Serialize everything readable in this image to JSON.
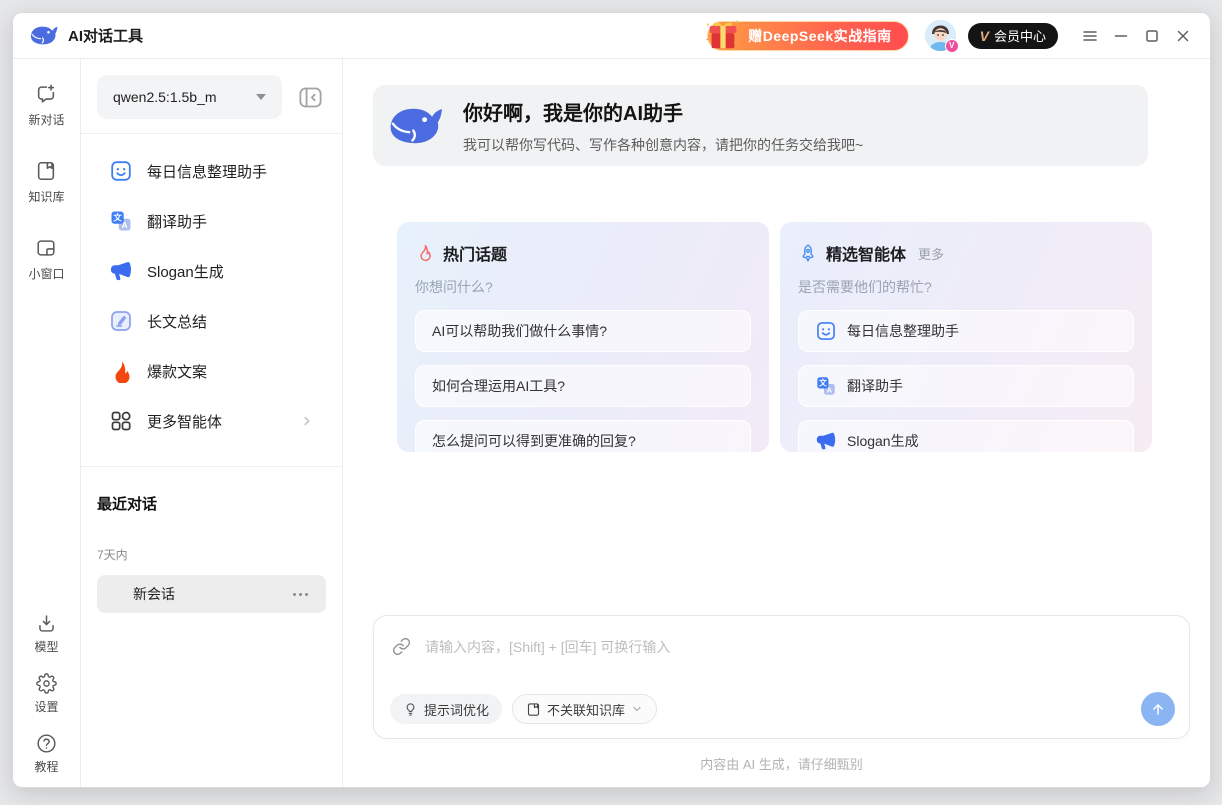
{
  "titlebar": {
    "app_title": "AI对话工具",
    "promo_label": "赠DeepSeek实战指南",
    "member_v": "V",
    "member_label": "会员中心"
  },
  "rail": {
    "new_chat": "新对话",
    "knowledge": "知识库",
    "mini_window": "小窗口",
    "models": "模型",
    "settings": "设置",
    "tutorial": "教程"
  },
  "sidebar": {
    "model_name": "qwen2.5:1.5b_m",
    "assistants": [
      {
        "label": "每日信息整理助手"
      },
      {
        "label": "翻译助手"
      },
      {
        "label": "Slogan生成"
      },
      {
        "label": "长文总结"
      },
      {
        "label": "爆款文案"
      },
      {
        "label": "更多智能体"
      }
    ],
    "recent_title": "最近对话",
    "recent_group": "7天内",
    "recent_item": "新会话"
  },
  "main": {
    "welcome": {
      "title": "你好啊，我是你的AI助手",
      "subtitle": "我可以帮你写代码、写作各种创意内容，请把你的任务交给我吧~"
    },
    "hot_topics": {
      "title": "热门话题",
      "subtitle": "你想问什么?",
      "questions": [
        "AI可以帮助我们做什么事情?",
        "如何合理运用AI工具?",
        "怎么提问可以得到更准确的回复?"
      ]
    },
    "agents": {
      "title": "精选智能体",
      "more_label": "更多",
      "subtitle": "是否需要他们的帮忙?",
      "items": [
        "每日信息整理助手",
        "翻译助手",
        "Slogan生成"
      ]
    },
    "composer": {
      "placeholder": "请输入内容，[Shift] + [回车] 可换行输入",
      "prompt_optimizer": "提示词优化",
      "knowledge_selector": "不关联知识库"
    },
    "disclaimer": "内容由 AI 生成，请仔细甄别"
  },
  "colors": {
    "brand_blue": "#4a6ce0",
    "accent_blue": "#3f7df6",
    "flame_red": "#f4470f",
    "hot_header_icon": "#f56c6c",
    "rocket_icon": "#4a90f0",
    "send_button": "#8ab5f2",
    "promo_gradient_start": "#ff9d45",
    "promo_gradient_end": "#ff4d4e"
  }
}
